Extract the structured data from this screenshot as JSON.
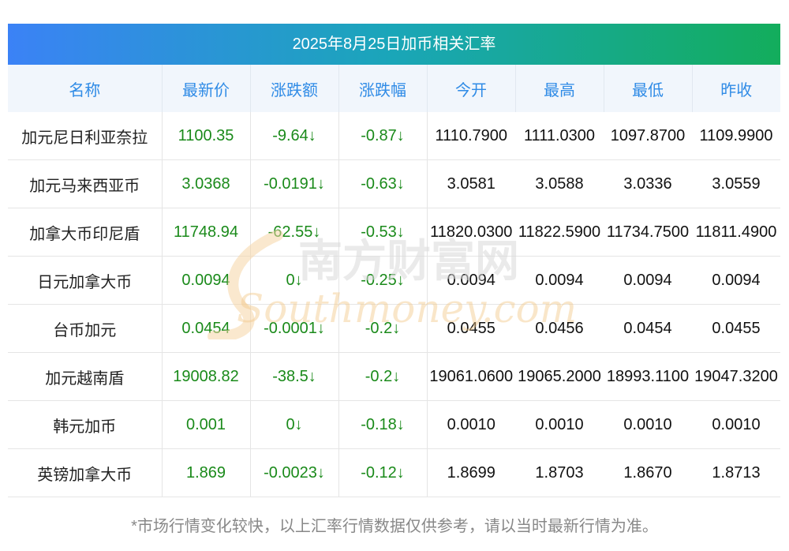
{
  "title": "2025年8月25日加币相关汇率",
  "headers": [
    "名称",
    "最新价",
    "涨跌额",
    "涨跌幅",
    "今开",
    "最高",
    "最低",
    "昨收"
  ],
  "rows": [
    {
      "name": "加元尼日利亚奈拉",
      "price": "1100.35",
      "change": "-9.64↓",
      "pct": "-0.87↓",
      "open": "1110.7900",
      "high": "1111.0300",
      "low": "1097.8700",
      "prev": "1109.9900"
    },
    {
      "name": "加元马来西亚币",
      "price": "3.0368",
      "change": "-0.0191↓",
      "pct": "-0.63↓",
      "open": "3.0581",
      "high": "3.0588",
      "low": "3.0336",
      "prev": "3.0559"
    },
    {
      "name": "加拿大币印尼盾",
      "price": "11748.94",
      "change": "-62.55↓",
      "pct": "-0.53↓",
      "open": "11820.0300",
      "high": "11822.5900",
      "low": "11734.7500",
      "prev": "11811.4900"
    },
    {
      "name": "日元加拿大币",
      "price": "0.0094",
      "change": "0↓",
      "pct": "-0.25↓",
      "open": "0.0094",
      "high": "0.0094",
      "low": "0.0094",
      "prev": "0.0094"
    },
    {
      "name": "台币加元",
      "price": "0.0454",
      "change": "-0.0001↓",
      "pct": "-0.2↓",
      "open": "0.0455",
      "high": "0.0456",
      "low": "0.0454",
      "prev": "0.0455"
    },
    {
      "name": "加元越南盾",
      "price": "19008.82",
      "change": "-38.5↓",
      "pct": "-0.2↓",
      "open": "19061.0600",
      "high": "19065.2000",
      "low": "18993.1100",
      "prev": "19047.3200"
    },
    {
      "name": "韩元加币",
      "price": "0.001",
      "change": "0↓",
      "pct": "-0.18↓",
      "open": "0.0010",
      "high": "0.0010",
      "low": "0.0010",
      "prev": "0.0010"
    },
    {
      "name": "英镑加拿大币",
      "price": "1.869",
      "change": "-0.0023↓",
      "pct": "-0.12↓",
      "open": "1.8699",
      "high": "1.8703",
      "low": "1.8670",
      "prev": "1.8713"
    }
  ],
  "watermark": {
    "cn": "南方财富网",
    "en": "Southmoney.com"
  },
  "footnote": "*市场行情变化较快，以上汇率行情数据仅供参考，请以当时最新行情为准。",
  "colors": {
    "header_text": "#2f8be6",
    "green": "#1a8a1a",
    "banner_start": "#3b82f6",
    "banner_end": "#13ad5c"
  },
  "chart_data": {
    "type": "table",
    "title": "2025年8月25日加币相关汇率",
    "columns": [
      "名称",
      "最新价",
      "涨跌额",
      "涨跌幅",
      "今开",
      "最高",
      "最低",
      "昨收"
    ],
    "rows": [
      [
        "加元尼日利亚奈拉",
        1100.35,
        -9.64,
        -0.87,
        1110.79,
        1111.03,
        1097.87,
        1109.99
      ],
      [
        "加元马来西亚币",
        3.0368,
        -0.0191,
        -0.63,
        3.0581,
        3.0588,
        3.0336,
        3.0559
      ],
      [
        "加拿大币印尼盾",
        11748.94,
        -62.55,
        -0.53,
        11820.03,
        11822.59,
        11734.75,
        11811.49
      ],
      [
        "日元加拿大币",
        0.0094,
        0,
        -0.25,
        0.0094,
        0.0094,
        0.0094,
        0.0094
      ],
      [
        "台币加元",
        0.0454,
        -0.0001,
        -0.2,
        0.0455,
        0.0456,
        0.0454,
        0.0455
      ],
      [
        "加元越南盾",
        19008.82,
        -38.5,
        -0.2,
        19061.06,
        19065.2,
        18993.11,
        19047.32
      ],
      [
        "韩元加币",
        0.001,
        0,
        -0.18,
        0.001,
        0.001,
        0.001,
        0.001
      ],
      [
        "英镑加拿大币",
        1.869,
        -0.0023,
        -0.12,
        1.8699,
        1.8703,
        1.867,
        1.8713
      ]
    ]
  }
}
